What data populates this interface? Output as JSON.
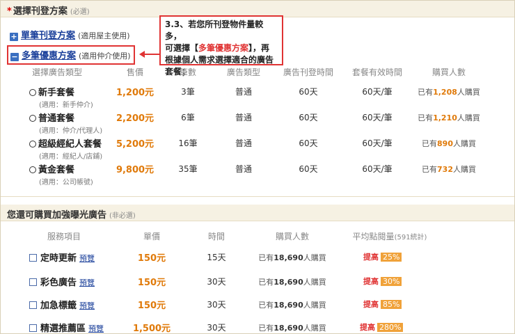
{
  "plan_section": {
    "req_mark": "*",
    "title": "選擇刊登方案",
    "note": "(必選)",
    "single_plan": {
      "toggle": "+",
      "label": "單筆刊登方案",
      "sub": "(適用屋主使用)"
    },
    "multi_plan": {
      "toggle": "−",
      "label": "多筆優惠方案",
      "sub": "(適用仲介使用)"
    },
    "callout": {
      "line1": "3.3、若您所刊登物件量較多，",
      "line2_pre": "可選擇【",
      "line2_hl": "多筆優惠方案",
      "line2_post": "】，再",
      "line3": "根據個人需求選擇適合的廣告",
      "line4": "套餐；"
    },
    "columns": [
      "選擇廣告類型",
      "售價",
      "筆數",
      "廣告類型",
      "廣告刊登時間",
      "套餐有效時間",
      "購買人數"
    ],
    "packages": [
      {
        "name": "新手套餐",
        "applies": "(適用：新手仲介)",
        "price": "1,200元",
        "count": "3筆",
        "type": "普通",
        "duration": "60天",
        "validity": "60天/筆",
        "buyers_pre": "已有",
        "buyers_num": "1,208",
        "buyers_post": "人購買"
      },
      {
        "name": "普通套餐",
        "applies": "(適用：仲介/代理人)",
        "price": "2,200元",
        "count": "6筆",
        "type": "普通",
        "duration": "60天",
        "validity": "60天/筆",
        "buyers_pre": "已有",
        "buyers_num": "1,210",
        "buyers_post": "人購買"
      },
      {
        "name": "超級經紀人套餐",
        "applies": "(適用：經紀人/店鋪)",
        "price": "5,200元",
        "count": "16筆",
        "type": "普通",
        "duration": "60天",
        "validity": "60天/筆",
        "buyers_pre": "已有",
        "buyers_num": "890",
        "buyers_post": "人購買"
      },
      {
        "name": "黃金套餐",
        "applies": "(適用：公司帳號)",
        "price": "9,800元",
        "count": "35筆",
        "type": "普通",
        "duration": "60天",
        "validity": "60天/筆",
        "buyers_pre": "已有",
        "buyers_num": "732",
        "buyers_post": "人購買"
      }
    ]
  },
  "extra_section": {
    "title": "您還可購買加強曝光廣告",
    "note": "(非必選)",
    "columns": [
      "服務項目",
      "單價",
      "時間",
      "購買人數",
      "平均點閱量",
      "(591統計)"
    ],
    "services": [
      {
        "name": "定時更新",
        "preview": "預覽",
        "price": "150元",
        "duration": "15天",
        "buyers_pre": "已有",
        "buyers_num": "18,690",
        "buyers_post": "人購買",
        "lift_label": "提高",
        "lift_pct": "25%"
      },
      {
        "name": "彩色廣告",
        "preview": "預覽",
        "price": "150元",
        "duration": "30天",
        "buyers_pre": "已有",
        "buyers_num": "18,690",
        "buyers_post": "人購買",
        "lift_label": "提高",
        "lift_pct": "30%"
      },
      {
        "name": "加急標籤",
        "preview": "預覽",
        "price": "150元",
        "duration": "30天",
        "buyers_pre": "已有",
        "buyers_num": "18,690",
        "buyers_post": "人購買",
        "lift_label": "提高",
        "lift_pct": "85%"
      },
      {
        "name": "精選推薦區",
        "preview": "預覽",
        "price": "1,500元",
        "duration": "30天",
        "buyers_pre": "已有",
        "buyers_num": "18,690",
        "buyers_post": "人購買",
        "lift_label": "提高",
        "lift_pct": "280%"
      }
    ]
  },
  "colors": {
    "accent_orange": "#e07a0a",
    "link_blue": "#1a3f9a",
    "highlight_red": "#e03333",
    "header_bg": "#f6f1e3"
  }
}
